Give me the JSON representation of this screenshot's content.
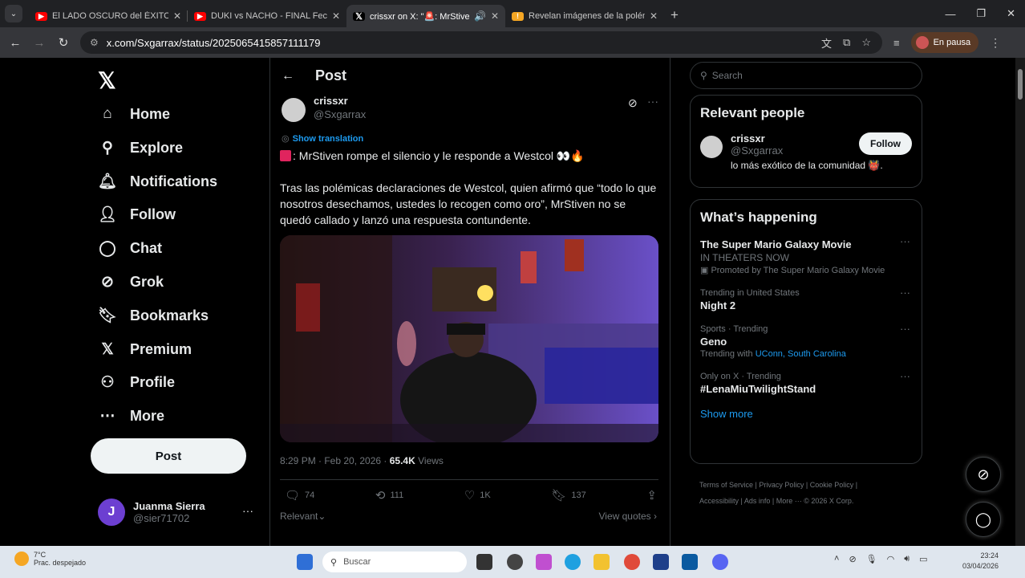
{
  "browser": {
    "tabs": [
      {
        "title": "El LADO OSCURO del ÉXITO de",
        "favicon_color": "#ff0000",
        "favicon_icon": "youtube-icon",
        "active": false
      },
      {
        "title": "DUKI vs NACHO - FINAL Fecha",
        "favicon_color": "#ff0000",
        "favicon_icon": "youtube-icon",
        "active": false
      },
      {
        "title": "crissxr on X: \"🚨: MrStiven",
        "favicon_color": "#000000",
        "favicon_icon": "x-icon",
        "active": true
      },
      {
        "title": "Revelan imágenes de la polémi",
        "favicon_color": "#f5a623",
        "favicon_icon": "news-icon",
        "active": false
      }
    ],
    "url": "x.com/Sxgarrax/status/2025065415857111179",
    "profile_status": "En pausa"
  },
  "sidebar": {
    "items": [
      {
        "label": "Home",
        "icon": "home-icon"
      },
      {
        "label": "Explore",
        "icon": "search-icon"
      },
      {
        "label": "Notifications",
        "icon": "bell-icon"
      },
      {
        "label": "Follow",
        "icon": "follow-icon"
      },
      {
        "label": "Chat",
        "icon": "chat-icon"
      },
      {
        "label": "Grok",
        "icon": "grok-icon"
      },
      {
        "label": "Bookmarks",
        "icon": "bookmark-icon"
      },
      {
        "label": "Premium",
        "icon": "x-premium-icon"
      },
      {
        "label": "Profile",
        "icon": "profile-icon"
      },
      {
        "label": "More",
        "icon": "more-icon"
      }
    ],
    "post_button": "Post",
    "account": {
      "initial": "J",
      "name": "Juanma Sierra",
      "handle": "@sier71702"
    }
  },
  "post": {
    "header": "Post",
    "author_name": "crissxr",
    "author_handle": "@Sxgarrax",
    "show_translation": "Show translation",
    "headline": ": MrStiven rompe el silencio y le responde a Westcol 👀🔥",
    "body": "Tras las polémicas declaraciones de Westcol, quien afirmó que “todo lo que nosotros desechamos, ustedes lo recogen como oro”, MrStiven no se quedó callado y lanzó una respuesta contundente.",
    "timestamp": "8:29 PM · Feb 20, 2026 · ",
    "views_count": "65.4K",
    "views_label": " Views",
    "replies": "74",
    "reposts": "111",
    "likes": "1K",
    "bookmarks": "137",
    "sort_label": "Relevant",
    "view_quotes": "View quotes"
  },
  "right": {
    "search_placeholder": "Search",
    "relevant_people_title": "Relevant people",
    "person": {
      "name": "crissxr",
      "handle": "@Sxgarrax",
      "bio": "lo más exótico de la comunidad 👹.",
      "follow_label": "Follow"
    },
    "happening_title": "What’s happening",
    "trends": [
      {
        "context": "",
        "title": "The Super Mario Galaxy Movie",
        "sub": "IN THEATERS NOW",
        "extra": "Promoted by The Super Mario Galaxy Movie"
      },
      {
        "context": "Trending in United States",
        "title": "Night 2",
        "sub": "",
        "extra": ""
      },
      {
        "context": "Sports · Trending",
        "title": "Geno",
        "sub": "",
        "extra": "Trending with ",
        "extra_link": "UConn, South Carolina"
      },
      {
        "context": "Only on X · Trending",
        "title": "#LenaMiuTwilightStand",
        "sub": "",
        "extra": ""
      }
    ],
    "show_more": "Show more",
    "footer_line1": "Terms of Service  |  Privacy Policy  |  Cookie Policy  |",
    "footer_line2": "Accessibility  |  Ads info  |  More ···  © 2026 X Corp."
  },
  "taskbar": {
    "weather_temp": "7°C",
    "weather_desc": "Prac. despejado",
    "search_placeholder": "Buscar",
    "time": "23:24",
    "date": "03/04/2026"
  }
}
